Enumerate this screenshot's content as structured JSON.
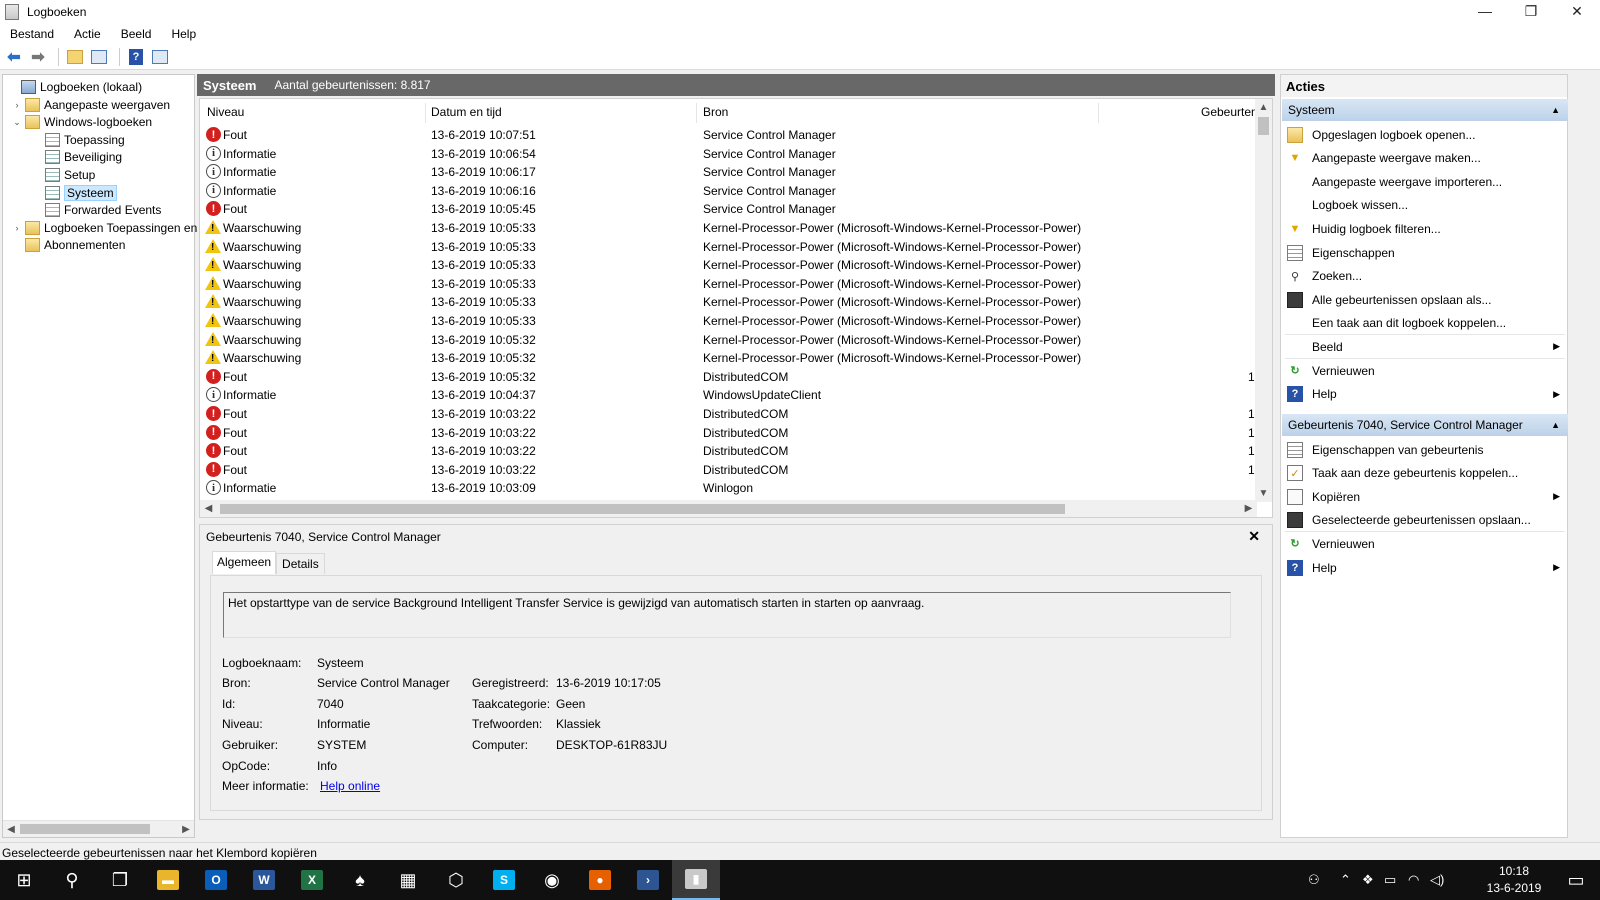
{
  "window": {
    "title": "Logboeken",
    "controls": {
      "minimize": "—",
      "maximize": "❐",
      "close": "✕"
    }
  },
  "menu": [
    "Bestand",
    "Actie",
    "Beeld",
    "Help"
  ],
  "toolbar": {
    "icons": [
      "back-arrow-icon",
      "forward-arrow-icon",
      "folder-up-icon",
      "show-hide-console-tree-icon",
      "help-icon",
      "show-hide-action-pane-icon"
    ]
  },
  "tree": {
    "items": [
      {
        "label": "Logboeken (lokaal)",
        "level": 0,
        "expander": "",
        "icon": "comp"
      },
      {
        "label": "Aangepaste weergaven",
        "level": 1,
        "expander": "›",
        "icon": "folder"
      },
      {
        "label": "Windows-logboeken",
        "level": 1,
        "expander": "⌄",
        "icon": "folder"
      },
      {
        "label": "Toepassing",
        "level": 2,
        "expander": "",
        "icon": "log"
      },
      {
        "label": "Beveiliging",
        "level": 2,
        "expander": "",
        "icon": "log"
      },
      {
        "label": "Setup",
        "level": 2,
        "expander": "",
        "icon": "log"
      },
      {
        "label": "Systeem",
        "level": 2,
        "expander": "",
        "icon": "log",
        "selected": true
      },
      {
        "label": "Forwarded Events",
        "level": 2,
        "expander": "",
        "icon": "log"
      },
      {
        "label": "Logboeken Toepassingen en",
        "level": 1,
        "expander": "›",
        "icon": "folder"
      },
      {
        "label": "Abonnementen",
        "level": 1,
        "expander": "",
        "icon": "folder"
      }
    ]
  },
  "center": {
    "title": "Systeem",
    "count_text": "Aantal gebeurtenissen: 8.817",
    "columns": [
      "Niveau",
      "Datum en tijd",
      "Bron",
      "Gebeurten"
    ],
    "rows": [
      {
        "level": "Fout",
        "type": "error",
        "datetime": "13-6-2019 10:07:51",
        "source": "Service Control Manager",
        "event": ""
      },
      {
        "level": "Informatie",
        "type": "info",
        "datetime": "13-6-2019 10:06:54",
        "source": "Service Control Manager",
        "event": ""
      },
      {
        "level": "Informatie",
        "type": "info",
        "datetime": "13-6-2019 10:06:17",
        "source": "Service Control Manager",
        "event": ""
      },
      {
        "level": "Informatie",
        "type": "info",
        "datetime": "13-6-2019 10:06:16",
        "source": "Service Control Manager",
        "event": ""
      },
      {
        "level": "Fout",
        "type": "error",
        "datetime": "13-6-2019 10:05:45",
        "source": "Service Control Manager",
        "event": ""
      },
      {
        "level": "Waarschuwing",
        "type": "warn",
        "datetime": "13-6-2019 10:05:33",
        "source": "Kernel-Processor-Power (Microsoft-Windows-Kernel-Processor-Power)",
        "event": ""
      },
      {
        "level": "Waarschuwing",
        "type": "warn",
        "datetime": "13-6-2019 10:05:33",
        "source": "Kernel-Processor-Power (Microsoft-Windows-Kernel-Processor-Power)",
        "event": ""
      },
      {
        "level": "Waarschuwing",
        "type": "warn",
        "datetime": "13-6-2019 10:05:33",
        "source": "Kernel-Processor-Power (Microsoft-Windows-Kernel-Processor-Power)",
        "event": ""
      },
      {
        "level": "Waarschuwing",
        "type": "warn",
        "datetime": "13-6-2019 10:05:33",
        "source": "Kernel-Processor-Power (Microsoft-Windows-Kernel-Processor-Power)",
        "event": ""
      },
      {
        "level": "Waarschuwing",
        "type": "warn",
        "datetime": "13-6-2019 10:05:33",
        "source": "Kernel-Processor-Power (Microsoft-Windows-Kernel-Processor-Power)",
        "event": ""
      },
      {
        "level": "Waarschuwing",
        "type": "warn",
        "datetime": "13-6-2019 10:05:33",
        "source": "Kernel-Processor-Power (Microsoft-Windows-Kernel-Processor-Power)",
        "event": ""
      },
      {
        "level": "Waarschuwing",
        "type": "warn",
        "datetime": "13-6-2019 10:05:32",
        "source": "Kernel-Processor-Power (Microsoft-Windows-Kernel-Processor-Power)",
        "event": ""
      },
      {
        "level": "Waarschuwing",
        "type": "warn",
        "datetime": "13-6-2019 10:05:32",
        "source": "Kernel-Processor-Power (Microsoft-Windows-Kernel-Processor-Power)",
        "event": ""
      },
      {
        "level": "Fout",
        "type": "error",
        "datetime": "13-6-2019 10:05:32",
        "source": "DistributedCOM",
        "event": "1"
      },
      {
        "level": "Informatie",
        "type": "info",
        "datetime": "13-6-2019 10:04:37",
        "source": "WindowsUpdateClient",
        "event": ""
      },
      {
        "level": "Fout",
        "type": "error",
        "datetime": "13-6-2019 10:03:22",
        "source": "DistributedCOM",
        "event": "1"
      },
      {
        "level": "Fout",
        "type": "error",
        "datetime": "13-6-2019 10:03:22",
        "source": "DistributedCOM",
        "event": "1"
      },
      {
        "level": "Fout",
        "type": "error",
        "datetime": "13-6-2019 10:03:22",
        "source": "DistributedCOM",
        "event": "1"
      },
      {
        "level": "Fout",
        "type": "error",
        "datetime": "13-6-2019 10:03:22",
        "source": "DistributedCOM",
        "event": "1"
      },
      {
        "level": "Informatie",
        "type": "info",
        "datetime": "13-6-2019 10:03:09",
        "source": "Winlogon",
        "event": ""
      }
    ]
  },
  "details": {
    "title": "Gebeurtenis 7040, Service Control Manager",
    "close": "✕",
    "tabs": [
      "Algemeen",
      "Details"
    ],
    "message": "Het opstarttype van de service Background Intelligent Transfer Service is gewijzigd van automatisch starten in starten op aanvraag.",
    "fields": {
      "logname_label": "Logboeknaam:",
      "logname": "Systeem",
      "source_label": "Bron:",
      "source": "Service Control Manager",
      "id_label": "Id:",
      "id": "7040",
      "level_label": "Niveau:",
      "level": "Informatie",
      "user_label": "Gebruiker:",
      "user": "SYSTEM",
      "opcode_label": "OpCode:",
      "opcode": "Info",
      "moreinfo_label": "Meer informatie:",
      "moreinfo_link": "Help online",
      "logged_label": "Geregistreerd:",
      "logged": "13-6-2019 10:17:05",
      "task_label": "Taakcategorie:",
      "task": "Geen",
      "keywords_label": "Trefwoorden:",
      "keywords": "Klassiek",
      "computer_label": "Computer:",
      "computer": "DESKTOP-61R83JU"
    }
  },
  "actions": {
    "header": "Acties",
    "section1": {
      "title": "Systeem",
      "items": [
        {
          "label": "Opgeslagen logboek openen...",
          "icon": "open-folder-icon",
          "cls": "ai-folder",
          "glyph": ""
        },
        {
          "label": "Aangepaste weergave maken...",
          "icon": "filter-icon",
          "cls": "ai-filter",
          "glyph": "▼"
        },
        {
          "label": "Aangepaste weergave importeren...",
          "icon": "",
          "cls": "",
          "glyph": ""
        },
        {
          "label": "Logboek wissen...",
          "icon": "",
          "cls": "",
          "glyph": ""
        },
        {
          "label": "Huidig logboek filteren...",
          "icon": "filter-icon",
          "cls": "ai-filter",
          "glyph": "▼"
        },
        {
          "label": "Eigenschappen",
          "icon": "properties-icon",
          "cls": "ai-props",
          "glyph": ""
        },
        {
          "label": "Zoeken...",
          "icon": "find-icon",
          "cls": "ai-find",
          "glyph": "⚲"
        },
        {
          "label": "Alle gebeurtenissen opslaan als...",
          "icon": "save-icon",
          "cls": "ai-save",
          "glyph": ""
        },
        {
          "label": "Een taak aan dit logboek koppelen...",
          "icon": "",
          "cls": "",
          "glyph": ""
        },
        {
          "label": "Beeld",
          "icon": "",
          "cls": "",
          "glyph": "",
          "submenu": "▶"
        },
        {
          "label": "Vernieuwen",
          "icon": "refresh-icon",
          "cls": "ai-refresh",
          "glyph": "↻"
        },
        {
          "label": "Help",
          "icon": "help-icon",
          "cls": "ai-help",
          "glyph": "?",
          "submenu": "▶"
        }
      ]
    },
    "section2": {
      "title": "Gebeurtenis 7040, Service Control Manager",
      "items": [
        {
          "label": "Eigenschappen van gebeurtenis",
          "icon": "properties-icon",
          "cls": "ai-props",
          "glyph": ""
        },
        {
          "label": "Taak aan deze gebeurtenis koppelen...",
          "icon": "task-icon",
          "cls": "ai-task",
          "glyph": "✓"
        },
        {
          "label": "Kopiëren",
          "icon": "copy-icon",
          "cls": "ai-copy",
          "glyph": "",
          "submenu": "▶"
        },
        {
          "label": "Geselecteerde gebeurtenissen opslaan...",
          "icon": "save-icon",
          "cls": "ai-save",
          "glyph": ""
        },
        {
          "label": "Vernieuwen",
          "icon": "refresh-icon",
          "cls": "ai-refresh",
          "glyph": "↻"
        },
        {
          "label": "Help",
          "icon": "help-icon",
          "cls": "ai-help",
          "glyph": "?",
          "submenu": "▶"
        }
      ]
    },
    "caret": "▲"
  },
  "status": {
    "text": "Geselecteerde gebeurtenissen naar het Klembord kopiëren"
  },
  "taskbar": {
    "apps": [
      {
        "name": "start-button",
        "glyph": "⊞",
        "color": ""
      },
      {
        "name": "search-icon",
        "glyph": "⚲",
        "color": ""
      },
      {
        "name": "task-view-icon",
        "glyph": "❐",
        "color": ""
      },
      {
        "name": "file-explorer-icon",
        "glyph": "▬",
        "color": "#e8b52b"
      },
      {
        "name": "outlook-icon",
        "glyph": "O",
        "color": "#0a5db8"
      },
      {
        "name": "word-icon",
        "glyph": "W",
        "color": "#2b579a"
      },
      {
        "name": "excel-icon",
        "glyph": "X",
        "color": "#217346"
      },
      {
        "name": "solitaire-icon",
        "glyph": "♠",
        "color": ""
      },
      {
        "name": "calculator-icon",
        "glyph": "▦",
        "color": ""
      },
      {
        "name": "3d-builder-icon",
        "glyph": "⬡",
        "color": ""
      },
      {
        "name": "skype-icon",
        "glyph": "S",
        "color": "#00aff0"
      },
      {
        "name": "camera-icon",
        "glyph": "◉",
        "color": ""
      },
      {
        "name": "firefox-icon",
        "glyph": "●",
        "color": "#e66000"
      },
      {
        "name": "powershell-icon",
        "glyph": "›",
        "color": "#2c5591"
      },
      {
        "name": "event-viewer-icon",
        "glyph": "▮",
        "color": "#c9c9c9"
      }
    ],
    "tray": [
      "people-icon",
      "chevron-up-icon",
      "dropbox-icon",
      "battery-icon",
      "wifi-icon",
      "volume-icon"
    ],
    "tray_glyphs": [
      "⚇",
      "⌃",
      "❖",
      "▭",
      "◠",
      "◁)"
    ],
    "clock_time": "10:18",
    "clock_date": "13-6-2019",
    "notification": "▭"
  }
}
